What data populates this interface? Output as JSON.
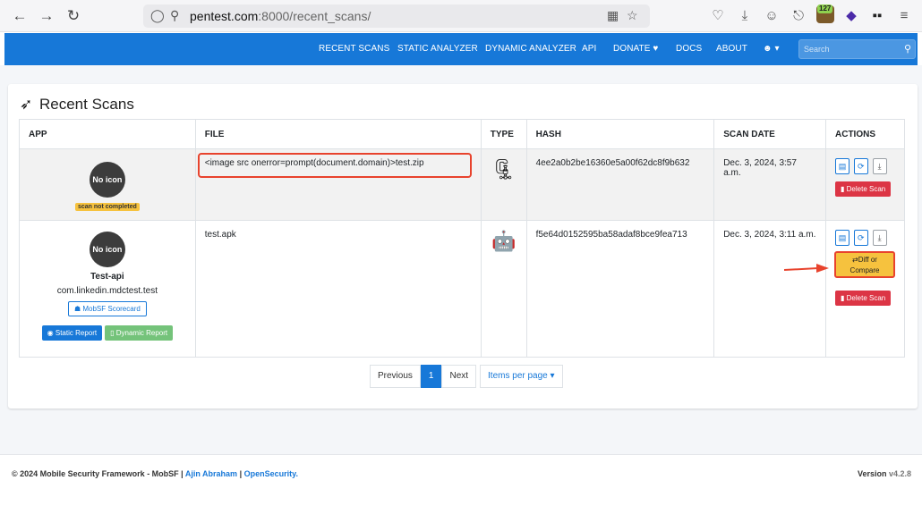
{
  "browser": {
    "url_host": "pentest.com",
    "url_path": ":8000/recent_scans/",
    "ext_count": "127"
  },
  "navbar": {
    "items": [
      "RECENT SCANS",
      "STATIC ANALYZER",
      "DYNAMIC ANALYZER",
      "API",
      "DONATE",
      "DOCS",
      "ABOUT"
    ],
    "search_placeholder": "Search",
    "brand_color": "#1778d8"
  },
  "page": {
    "title": "Recent Scans"
  },
  "table": {
    "headers": [
      "APP",
      "FILE",
      "TYPE",
      "HASH",
      "SCAN DATE",
      "ACTIONS"
    ],
    "rows": [
      {
        "app_icon_text": "No icon",
        "status_badge": "scan not completed",
        "file": "<image src onerror=prompt(document.domain)>test.zip",
        "type_icon": "zip-file-icon",
        "hash": "4ee2a0b2be16360e5a00f62dc8f9b632",
        "scan_date": "Dec. 3, 2024, 3:57 a.m.",
        "delete_label": "Delete Scan"
      },
      {
        "app_icon_text": "No icon",
        "app_name": "Test-api",
        "package": "com.linkedin.mdctest.test",
        "scorecard_label": "MobSF Scorecard",
        "static_report_label": "Static Report",
        "dynamic_report_label": "Dynamic Report",
        "file": "test.apk",
        "type_icon": "android-icon",
        "hash": "f5e64d0152595ba58adaf8bce9fea713",
        "scan_date": "Dec. 3, 2024, 3:11 a.m.",
        "diff_label_1": "Diff or",
        "diff_label_2": "Compare",
        "delete_label": "Delete Scan"
      }
    ]
  },
  "pagination": {
    "previous": "Previous",
    "current": "1",
    "next": "Next",
    "items_per_page": "Items per page"
  },
  "footer": {
    "prefix": "© 2024 Mobile Security Framework - MobSF |",
    "author": "Ajin Abraham",
    "sep": "|",
    "org": "OpenSecurity.",
    "version_label": "Version",
    "version": "v4.2.8"
  }
}
